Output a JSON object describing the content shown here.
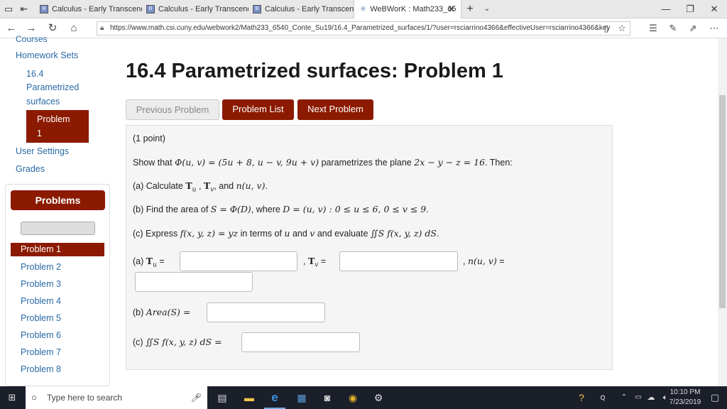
{
  "browser": {
    "tabs": [
      {
        "title": "Calculus - Early Transcender"
      },
      {
        "title": "Calculus - Early Transcender"
      },
      {
        "title": "Calculus - Early Transcender"
      },
      {
        "title": "WeBWorK : Math233_65"
      }
    ],
    "url": "https://www.math.csi.cuny.edu/webwork2/Math233_6540_Conte_Su19/16.4_Parametrized_surfaces/1/?user=rsciarrino4366&effectiveUser=rsciarrino4366&key"
  },
  "sidebar": {
    "cut_off": "Courses",
    "homework_sets": "Homework Sets",
    "set_line1": "16.4",
    "set_line2": "Parametrized",
    "set_line3": "surfaces",
    "problem_line1": "Problem",
    "problem_line2": "1",
    "user_settings": "User Settings",
    "grades": "Grades",
    "problems_header": "Problems",
    "problem_items": [
      "Problem 1",
      "Problem 2",
      "Problem 3",
      "Problem 4",
      "Problem 5",
      "Problem 6",
      "Problem 7",
      "Problem 8"
    ]
  },
  "main": {
    "title": "16.4 Parametrized surfaces: Problem 1",
    "prev_button": "Previous Problem",
    "list_button": "Problem List",
    "next_button": "Next Problem",
    "points": "(1 point)",
    "show_that": "Show that",
    "phi_def": "Φ(u, v) = (5u + 8, u − v, 9u + v)",
    "parametrizes": "parametrizes the plane",
    "plane": "2x − y − z = 16",
    "then": ". Then:",
    "part_a_label": "(a) Calculate",
    "part_a_math": "T",
    "part_a_rest": "and",
    "n_uv": "n(u, v)",
    "part_b_label": "(b) Find the area of",
    "part_b_math": "S = Φ(D)",
    "where": ", where",
    "domain": "D = (u, v) : 0 ≤ u ≤ 6, 0 ≤ v ≤ 9",
    "part_c_label": "(c) Express",
    "f_def": "f(x, y, z) = yz",
    "in_terms": "in terms of",
    "u": "u",
    "and": "and",
    "v": "v",
    "and_evaluate": "and evaluate",
    "integral": "∬S f(x, y, z) dS",
    "ans_a_label": "(a)",
    "ans_b_label": "(b)",
    "area_expr": "Area(S) =",
    "ans_c_label": "(c)",
    "integral_eq": "∬S f(x, y, z) dS ="
  },
  "taskbar": {
    "search_placeholder": "Type here to search",
    "time": "10:10 PM",
    "date": "7/23/2019"
  },
  "colors": {
    "maroon": "#8b1a00",
    "link": "#2a6aa5"
  }
}
